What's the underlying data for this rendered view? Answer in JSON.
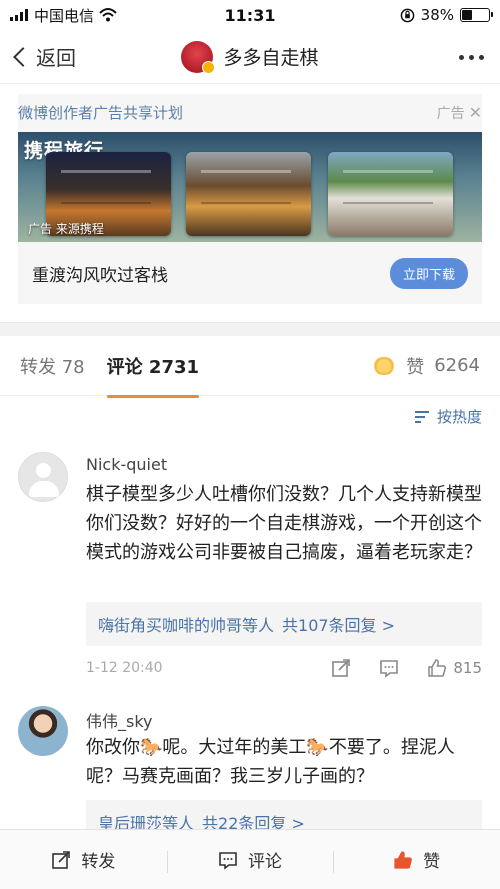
{
  "status_bar": {
    "carrier": "中国电信",
    "time": "11:31",
    "battery": "38%",
    "battery_level": 0.38
  },
  "nav": {
    "back_label": "返回",
    "title": "多多自走棋"
  },
  "ad": {
    "source": "微博创作者广告共享计划",
    "tag": "广告",
    "brand": "携程旅行",
    "caption": "广告 来源携程",
    "title": "重渡沟风吹过客栈",
    "cta": "立即下载"
  },
  "tabs": {
    "repost_label": "转发",
    "repost_count": "78",
    "comment_label": "评论",
    "comment_count": "2731",
    "like_label": "赞",
    "like_count": "6264"
  },
  "sort_label": "按热度",
  "comments": [
    {
      "name": "Nick-quiet",
      "text": "棋子模型多少人吐槽你们没数？几个人支持新模型你们没数？好好的一个自走棋游戏，一个开创这个模式的游戏公司非要被自己搞废，逼着老玩家走？",
      "reply_users": "嗨街角买咖啡的帅哥等人",
      "reply_count": "共107条回复 >",
      "time": "1-12 20:40",
      "likes": "815"
    },
    {
      "name": "伟伟_sky",
      "text_parts": [
        "你改你",
        "呢。大过年的美工",
        "不要了。捏泥人呢？马赛克画面？我三岁儿子画的？"
      ],
      "reply_users": "皇后珊莎等人",
      "reply_count": "共22条回复 >"
    }
  ],
  "bottom_bar": {
    "repost": "转发",
    "comment": "评论",
    "like": "赞"
  },
  "colors": {
    "link": "#4a73a8",
    "accent": "#f08a2c",
    "cta": "#5b8ddb",
    "like_active": "#e8542c"
  }
}
